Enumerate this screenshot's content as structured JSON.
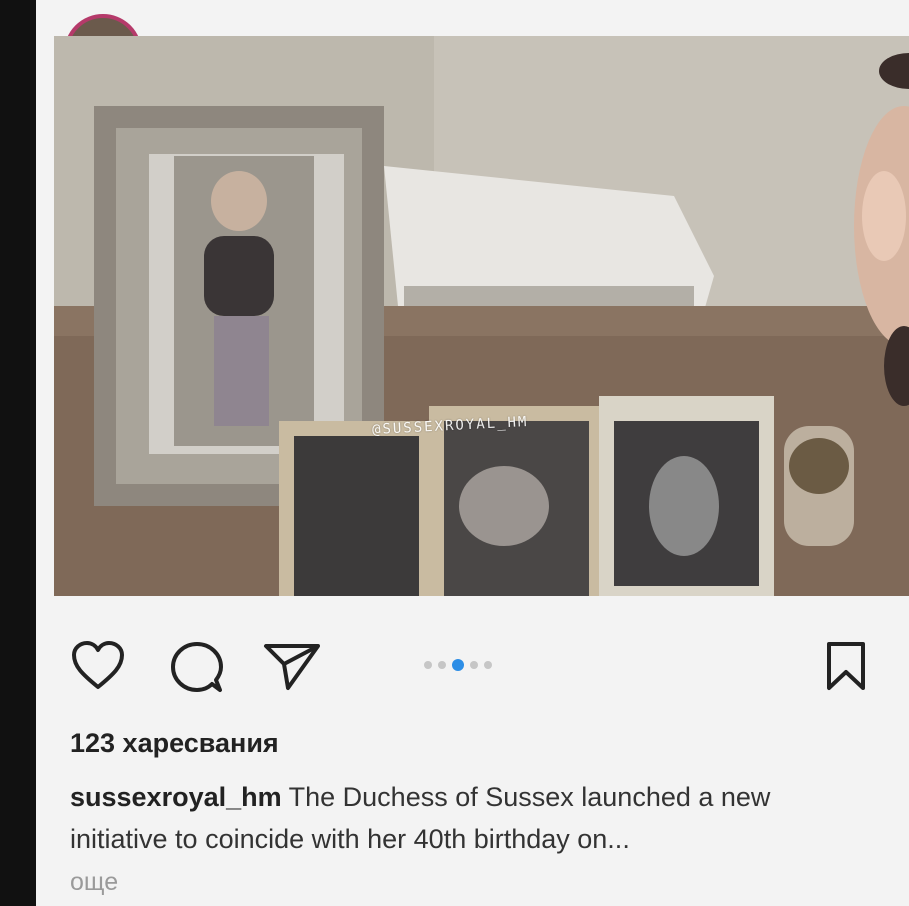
{
  "post": {
    "watermark": "@SUSSEXROYAL_HM",
    "likes": "123 харесвания",
    "username": "sussexroyal_hm",
    "caption_text": " The Duchess of Sussex launched a new initiative to coincide with her 40th birthday on...",
    "more_label": "още"
  },
  "actions": {
    "icons": [
      "heart-icon",
      "comment-icon",
      "share-icon",
      "bookmark-icon"
    ]
  },
  "carousel": {
    "total": 5,
    "active_index": 2,
    "active_color": "#2d8ee6"
  },
  "colors": {
    "background": "#f3f3f3",
    "avatar_ring": "#b53a6a"
  }
}
